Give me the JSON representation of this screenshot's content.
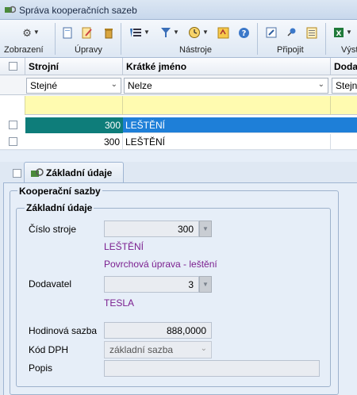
{
  "window": {
    "title": "Správa kooperačních sazeb"
  },
  "ribbon": {
    "groups": [
      "Zobrazení",
      "Úpravy",
      "Nástroje",
      "Připojit",
      "Výst"
    ]
  },
  "grid": {
    "columns": [
      "Strojní",
      "Krátké jméno",
      "Dodav"
    ],
    "filters": [
      "Stejné",
      "Nelze",
      "Stejn"
    ],
    "rows": [
      {
        "number": "300",
        "name": "LEŠTĚNÍ",
        "selected": true
      },
      {
        "number": "300",
        "name": "LEŠTĚNÍ",
        "selected": false
      }
    ],
    "colors": {
      "selected_row": "#1e7fd8",
      "selected_number_cell": "#0e7d7a",
      "new_row": "#fffbb0"
    }
  },
  "tabs": [
    {
      "label": "Základní údaje",
      "active": true
    }
  ],
  "form": {
    "outer_group": "Kooperační sazby",
    "inner_group": "Základní údaje",
    "machine_label": "Číslo stroje",
    "machine_value": "300",
    "machine_name": "LEŠTĚNÍ",
    "machine_desc": "Povrchová úprava - leštění",
    "supplier_label": "Dodavatel",
    "supplier_value": "3",
    "supplier_name": "TESLA",
    "rate_label": "Hodinová sazba",
    "rate_value": "888,0000",
    "vat_label": "Kód DPH",
    "vat_value": "základní sazba",
    "note_label": "Popis",
    "note_value": ""
  }
}
